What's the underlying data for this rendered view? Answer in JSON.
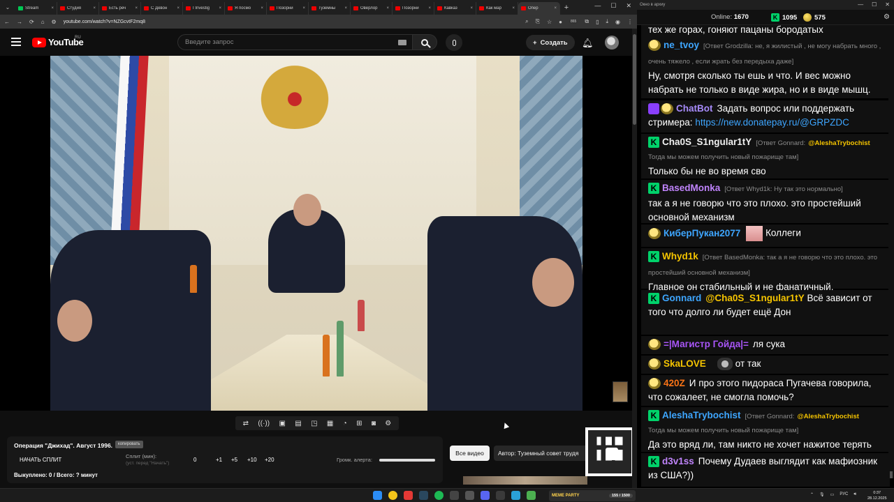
{
  "browser": {
    "tabs": [
      {
        "title": "Stream",
        "fav": "green"
      },
      {
        "title": "Студия",
        "fav": "red"
      },
      {
        "title": "Есть реч",
        "fav": "red"
      },
      {
        "title": "С Девон",
        "fav": "red"
      },
      {
        "title": "I Investig",
        "fav": "red"
      },
      {
        "title": "Я посмо",
        "fav": "red"
      },
      {
        "title": "Позорни",
        "fav": "red"
      },
      {
        "title": "Туземны",
        "fav": "red"
      },
      {
        "title": "Оверлор",
        "fav": "red"
      },
      {
        "title": "Позорни",
        "fav": "red"
      },
      {
        "title": "Кавказ",
        "fav": "red"
      },
      {
        "title": "Как мар",
        "fav": "red"
      },
      {
        "title": "Опер",
        "fav": "red"
      }
    ],
    "url": "youtube.com/watch?v=NZGcvtF2mq8",
    "ext_badge": "865"
  },
  "yt": {
    "logo": "YouTube",
    "region": "RU",
    "search_placeholder": "Введите запрос",
    "create_label": "Создать"
  },
  "player": {
    "op_title": "Операция \"Джихад\". Август 1996.",
    "copy_label": "копировать",
    "start_split": "НАЧАТЬ СПЛИТ",
    "split_label": "Сплит (мин):",
    "split_hint": "(уст. перед \"Начать\")",
    "split_value": "0",
    "inc1": "+1",
    "inc5": "+5",
    "inc10": "+10",
    "inc20": "+20",
    "alert_label": "Громк. алерта:",
    "alert_level": 1.0,
    "bought": "Выкуплено: 0 / Всего: ? минут",
    "all_video": "Все видео",
    "author": "Автор: Туземный совет трудя"
  },
  "chat": {
    "window_title": "Окно в архиу",
    "online_label": "Online:",
    "online_count": "1670",
    "kick_count": "1095",
    "points": "575",
    "first_line": "тех же горах, гоняют пацаны бородатых",
    "messages": [
      {
        "user": "ne_tvoy",
        "color": "#3ea6ff",
        "badges": [
          "face"
        ],
        "reply": "[Ответ Grodzilla: не, я жилистый , не могу набрать много , очень тяжело , если жрать без передыха даже]",
        "text": "Ну, смотря сколько ты ешь и что. И вес можно набрать не только в виде жира, но и в виде мышц."
      },
      {
        "user": "ChatBot",
        "color": "#a78bfa",
        "badges": [
          "bot",
          "face"
        ],
        "text": "Задать вопрос или поддержать стримера:",
        "link": "https://new.donatepay.ru/@GRPZDC"
      },
      {
        "user": "Cha0S_S1ngular1tY",
        "color": "#f0f0f0",
        "badges": [
          "kick"
        ],
        "reply": "[Ответ Gonnard:",
        "mention": "@AleshaTrybochist",
        "reply2": "Тогда мы можем получить новый пожарище там]",
        "text": "Только бы не во время сво"
      },
      {
        "user": "BasedMonka",
        "color": "#c084fc",
        "badges": [
          "kick"
        ],
        "reply": "[Ответ Whyd1k: Ну так это нормально]",
        "text": "так а я не говорю что это плохо. это простейший основной механизм"
      },
      {
        "user": "КиберПукан2077",
        "color": "#3ea6ff",
        "badges": [
          "face"
        ],
        "text": "Коллеги"
      },
      {
        "user": "Whyd1k",
        "color": "#f5c400",
        "badges": [
          "kick"
        ],
        "reply": "[Ответ BasedMonka: так а я не говорю что это плохо. это простейший основной механизм]",
        "text": "Главное он стабильный и не фанатичный."
      },
      {
        "user": "Gonnard",
        "color": "#3ea6ff",
        "badges": [
          "kick"
        ],
        "mention": "@Cha0S_S1ngular1tY",
        "text": "Всё зависит от того что долго ли будет ещё Дон"
      },
      {
        "user": "=|Магистр Гойда|=",
        "color": "#a855f7",
        "badges": [
          "face"
        ],
        "text": "ля сука"
      },
      {
        "user": "SkaLOVE",
        "color": "#f5c400",
        "badges": [
          "face"
        ],
        "text": "от так"
      },
      {
        "user": "420Z",
        "color": "#f97316",
        "badges": [
          "face"
        ],
        "text": "И про этого пидораса Пугачева говорила, что сожалеет, не смогла помочь?"
      },
      {
        "user": "AleshaTrybochist",
        "color": "#3ea6ff",
        "badges": [
          "kick"
        ],
        "reply": "[Ответ Gonnard:",
        "mention": "@AleshaTrybochist",
        "reply2": "Тогда мы можем получить новый пожарище там]",
        "text": "Да это вряд ли, там никто не хочет нажитое терять"
      },
      {
        "user": "d3v1ss",
        "color": "#c084fc",
        "badges": [
          "kick"
        ],
        "text": "Почему Дудаев выглядит как мафиозник из США?))"
      }
    ]
  },
  "taskbar": {
    "stream_label": "MEME PARTY",
    "stream_counter": "155 / 1500",
    "lang": "РУС",
    "time": "0:37",
    "date": "28.12.2025"
  }
}
